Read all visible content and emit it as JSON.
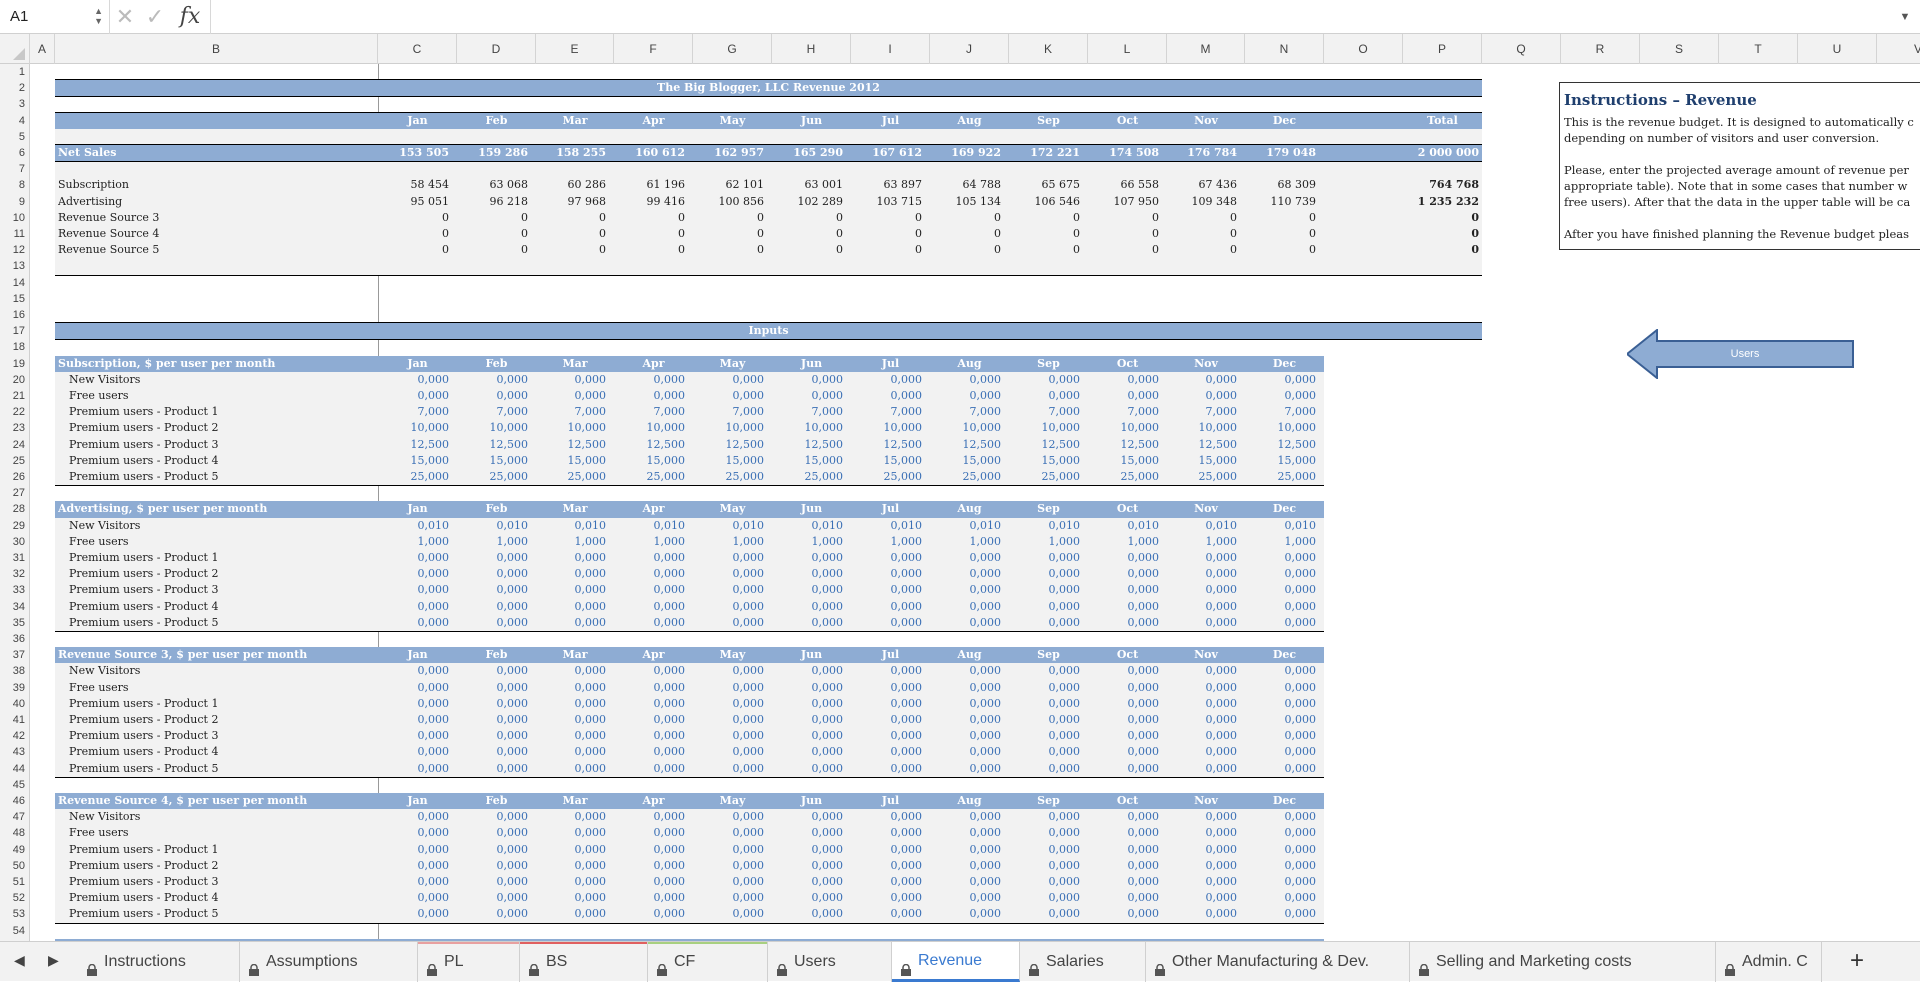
{
  "formula_bar": {
    "cell_ref": "A1",
    "fx_label": "fx",
    "formula": ""
  },
  "columns": [
    "A",
    "B",
    "C",
    "D",
    "E",
    "F",
    "G",
    "H",
    "I",
    "J",
    "K",
    "L",
    "M",
    "N",
    "O",
    "P",
    "Q",
    "R",
    "S",
    "T",
    "U",
    "V"
  ],
  "months": [
    "Jan",
    "Feb",
    "Mar",
    "Apr",
    "May",
    "Jun",
    "Jul",
    "Aug",
    "Sep",
    "Oct",
    "Nov",
    "Dec"
  ],
  "title": "The Big Blogger, LLC Revenue 2012",
  "total_label": "Total",
  "summary": {
    "net_sales": {
      "label": "Net Sales",
      "values": [
        "153 505",
        "159 286",
        "158 255",
        "160 612",
        "162 957",
        "165 290",
        "167 612",
        "169 922",
        "172 221",
        "174 508",
        "176 784",
        "179 048"
      ],
      "total": "2 000 000"
    },
    "rows": [
      {
        "label": "Subscription",
        "values": [
          "58 454",
          "63 068",
          "60 286",
          "61 196",
          "62 101",
          "63 001",
          "63 897",
          "64 788",
          "65 675",
          "66 558",
          "67 436",
          "68 309"
        ],
        "total": "764 768"
      },
      {
        "label": "Advertising",
        "values": [
          "95 051",
          "96 218",
          "97 968",
          "99 416",
          "100 856",
          "102 289",
          "103 715",
          "105 134",
          "106 546",
          "107 950",
          "109 348",
          "110 739"
        ],
        "total": "1 235 232"
      },
      {
        "label": "Revenue Source 3",
        "values": [
          "0",
          "0",
          "0",
          "0",
          "0",
          "0",
          "0",
          "0",
          "0",
          "0",
          "0",
          "0"
        ],
        "total": "0"
      },
      {
        "label": "Revenue Source 4",
        "values": [
          "0",
          "0",
          "0",
          "0",
          "0",
          "0",
          "0",
          "0",
          "0",
          "0",
          "0",
          "0"
        ],
        "total": "0"
      },
      {
        "label": "Revenue Source 5",
        "values": [
          "0",
          "0",
          "0",
          "0",
          "0",
          "0",
          "0",
          "0",
          "0",
          "0",
          "0",
          "0"
        ],
        "total": "0"
      }
    ]
  },
  "inputs_title": "Inputs",
  "input_tables": [
    {
      "title": "Subscription, $ per user per month",
      "rows": [
        {
          "label": "New Visitors",
          "value": "0,000"
        },
        {
          "label": "Free users",
          "value": "0,000"
        },
        {
          "label": "Premium users - Product 1",
          "value": "7,000"
        },
        {
          "label": "Premium users - Product 2",
          "value": "10,000"
        },
        {
          "label": "Premium users - Product 3",
          "value": "12,500"
        },
        {
          "label": "Premium users - Product 4",
          "value": "15,000"
        },
        {
          "label": "Premium users - Product 5",
          "value": "25,000"
        }
      ]
    },
    {
      "title": "Advertising, $ per user per month",
      "rows": [
        {
          "label": "New Visitors",
          "value": "0,010"
        },
        {
          "label": "Free users",
          "value": "1,000"
        },
        {
          "label": "Premium users - Product 1",
          "value": "0,000"
        },
        {
          "label": "Premium users - Product 2",
          "value": "0,000"
        },
        {
          "label": "Premium users - Product 3",
          "value": "0,000"
        },
        {
          "label": "Premium users - Product 4",
          "value": "0,000"
        },
        {
          "label": "Premium users - Product 5",
          "value": "0,000"
        }
      ]
    },
    {
      "title": "Revenue Source 3, $ per user per month",
      "rows": [
        {
          "label": "New Visitors",
          "value": "0,000"
        },
        {
          "label": "Free users",
          "value": "0,000"
        },
        {
          "label": "Premium users - Product 1",
          "value": "0,000"
        },
        {
          "label": "Premium users - Product 2",
          "value": "0,000"
        },
        {
          "label": "Premium users - Product 3",
          "value": "0,000"
        },
        {
          "label": "Premium users - Product 4",
          "value": "0,000"
        },
        {
          "label": "Premium users - Product 5",
          "value": "0,000"
        }
      ]
    },
    {
      "title": "Revenue Source 4, $ per user per month",
      "rows": [
        {
          "label": "New Visitors",
          "value": "0,000"
        },
        {
          "label": "Free users",
          "value": "0,000"
        },
        {
          "label": "Premium users - Product 1",
          "value": "0,000"
        },
        {
          "label": "Premium users - Product 2",
          "value": "0,000"
        },
        {
          "label": "Premium users - Product 3",
          "value": "0,000"
        },
        {
          "label": "Premium users - Product 4",
          "value": "0,000"
        },
        {
          "label": "Premium users - Product 5",
          "value": "0,000"
        }
      ]
    }
  ],
  "instructions": {
    "title": "Instructions – Revenue",
    "lines": [
      "This is the revenue budget. It is designed to automatically c",
      "depending on number of visitors and user conversion.",
      "",
      "Please, enter the projected average amount of revenue per",
      "appropriate table). Note that in some cases that number w",
      "free users). After that the data in the upper table will be ca",
      "",
      "After you have finished planning the Revenue budget pleas"
    ]
  },
  "users_button": "Users",
  "tabs": [
    {
      "label": "Instructions",
      "stripe": ""
    },
    {
      "label": "Assumptions",
      "stripe": ""
    },
    {
      "label": "PL",
      "stripe": "#e8a0a0"
    },
    {
      "label": "BS",
      "stripe": "#e06060"
    },
    {
      "label": "CF",
      "stripe": "#a8d080"
    },
    {
      "label": "Users",
      "stripe": ""
    },
    {
      "label": "Revenue",
      "stripe": "",
      "active": true
    },
    {
      "label": "Salaries",
      "stripe": ""
    },
    {
      "label": "Other Manufacturing & Dev.",
      "stripe": ""
    },
    {
      "label": "Selling and Marketing costs",
      "stripe": ""
    },
    {
      "label": "Admin. C",
      "stripe": ""
    }
  ],
  "colors": {
    "band": "#8eacd3",
    "input_text": "#3a6fb5",
    "active_tab": "#3a7ad0"
  }
}
